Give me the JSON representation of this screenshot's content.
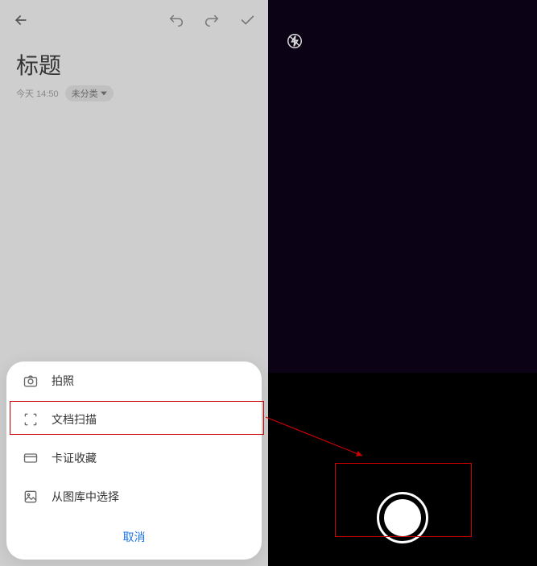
{
  "header": {
    "title": "标题",
    "timestamp": "今天 14:50",
    "category_label": "未分类"
  },
  "sheet": {
    "items": [
      {
        "label": "拍照"
      },
      {
        "label": "文档扫描"
      },
      {
        "label": "卡证收藏"
      },
      {
        "label": "从图库中选择"
      }
    ],
    "cancel": "取消"
  },
  "colors": {
    "highlight": "#c00",
    "accent": "#1a73e8"
  }
}
